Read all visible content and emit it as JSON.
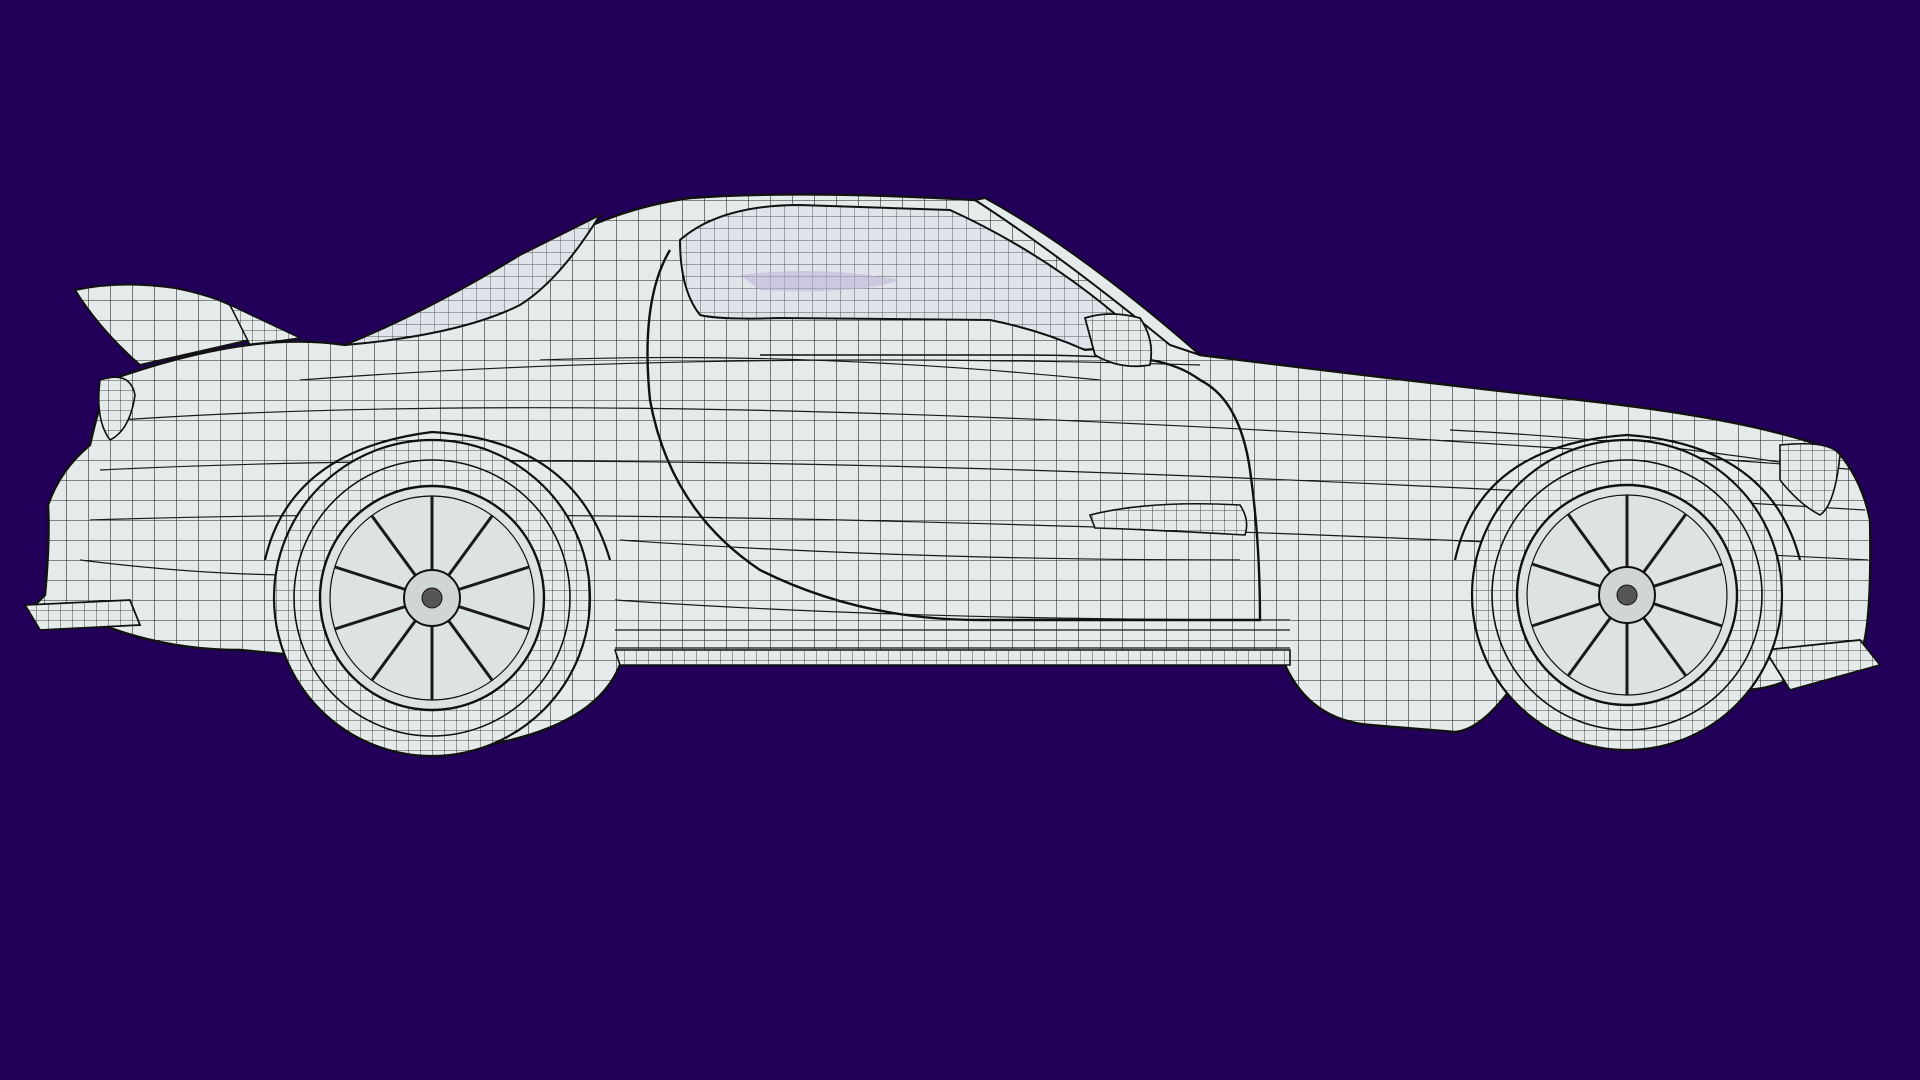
{
  "scene": {
    "background_color": "#22005a",
    "mesh_fill_color": "#e4ebea",
    "wire_color": "#1a1a1a",
    "glass_tint_color": "#b9b3d6",
    "render_mode": "wireframe-on-shaded",
    "subject": "sports-car-side-view",
    "facing": "right"
  }
}
